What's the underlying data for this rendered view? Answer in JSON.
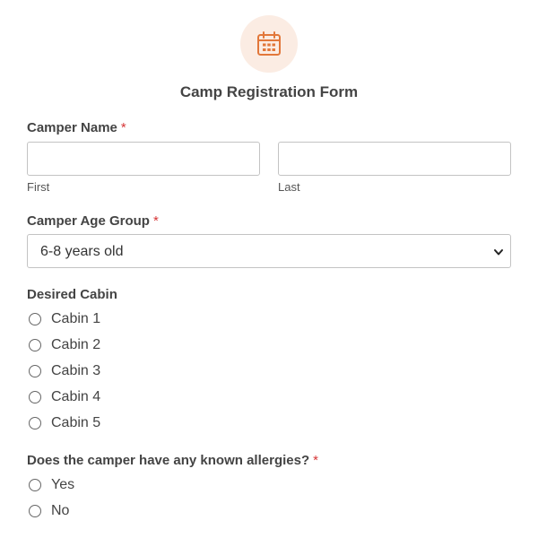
{
  "header": {
    "icon": "calendar-icon",
    "icon_color": "#e2773a",
    "icon_bg": "#fbece3",
    "title": "Camp Registration Form"
  },
  "camper_name": {
    "label": "Camper Name",
    "required_mark": "*",
    "first": {
      "value": "",
      "sublabel": "First"
    },
    "last": {
      "value": "",
      "sublabel": "Last"
    }
  },
  "age_group": {
    "label": "Camper Age Group",
    "required_mark": "*",
    "selected": "6-8 years old"
  },
  "cabin": {
    "label": "Desired Cabin",
    "options": [
      "Cabin 1",
      "Cabin 2",
      "Cabin 3",
      "Cabin 4",
      "Cabin 5"
    ]
  },
  "allergies": {
    "label": "Does the camper have any known allergies?",
    "required_mark": "*",
    "options": [
      "Yes",
      "No"
    ]
  },
  "colors": {
    "required": "#d63637",
    "border": "#c3c3c3",
    "text": "#444444"
  }
}
